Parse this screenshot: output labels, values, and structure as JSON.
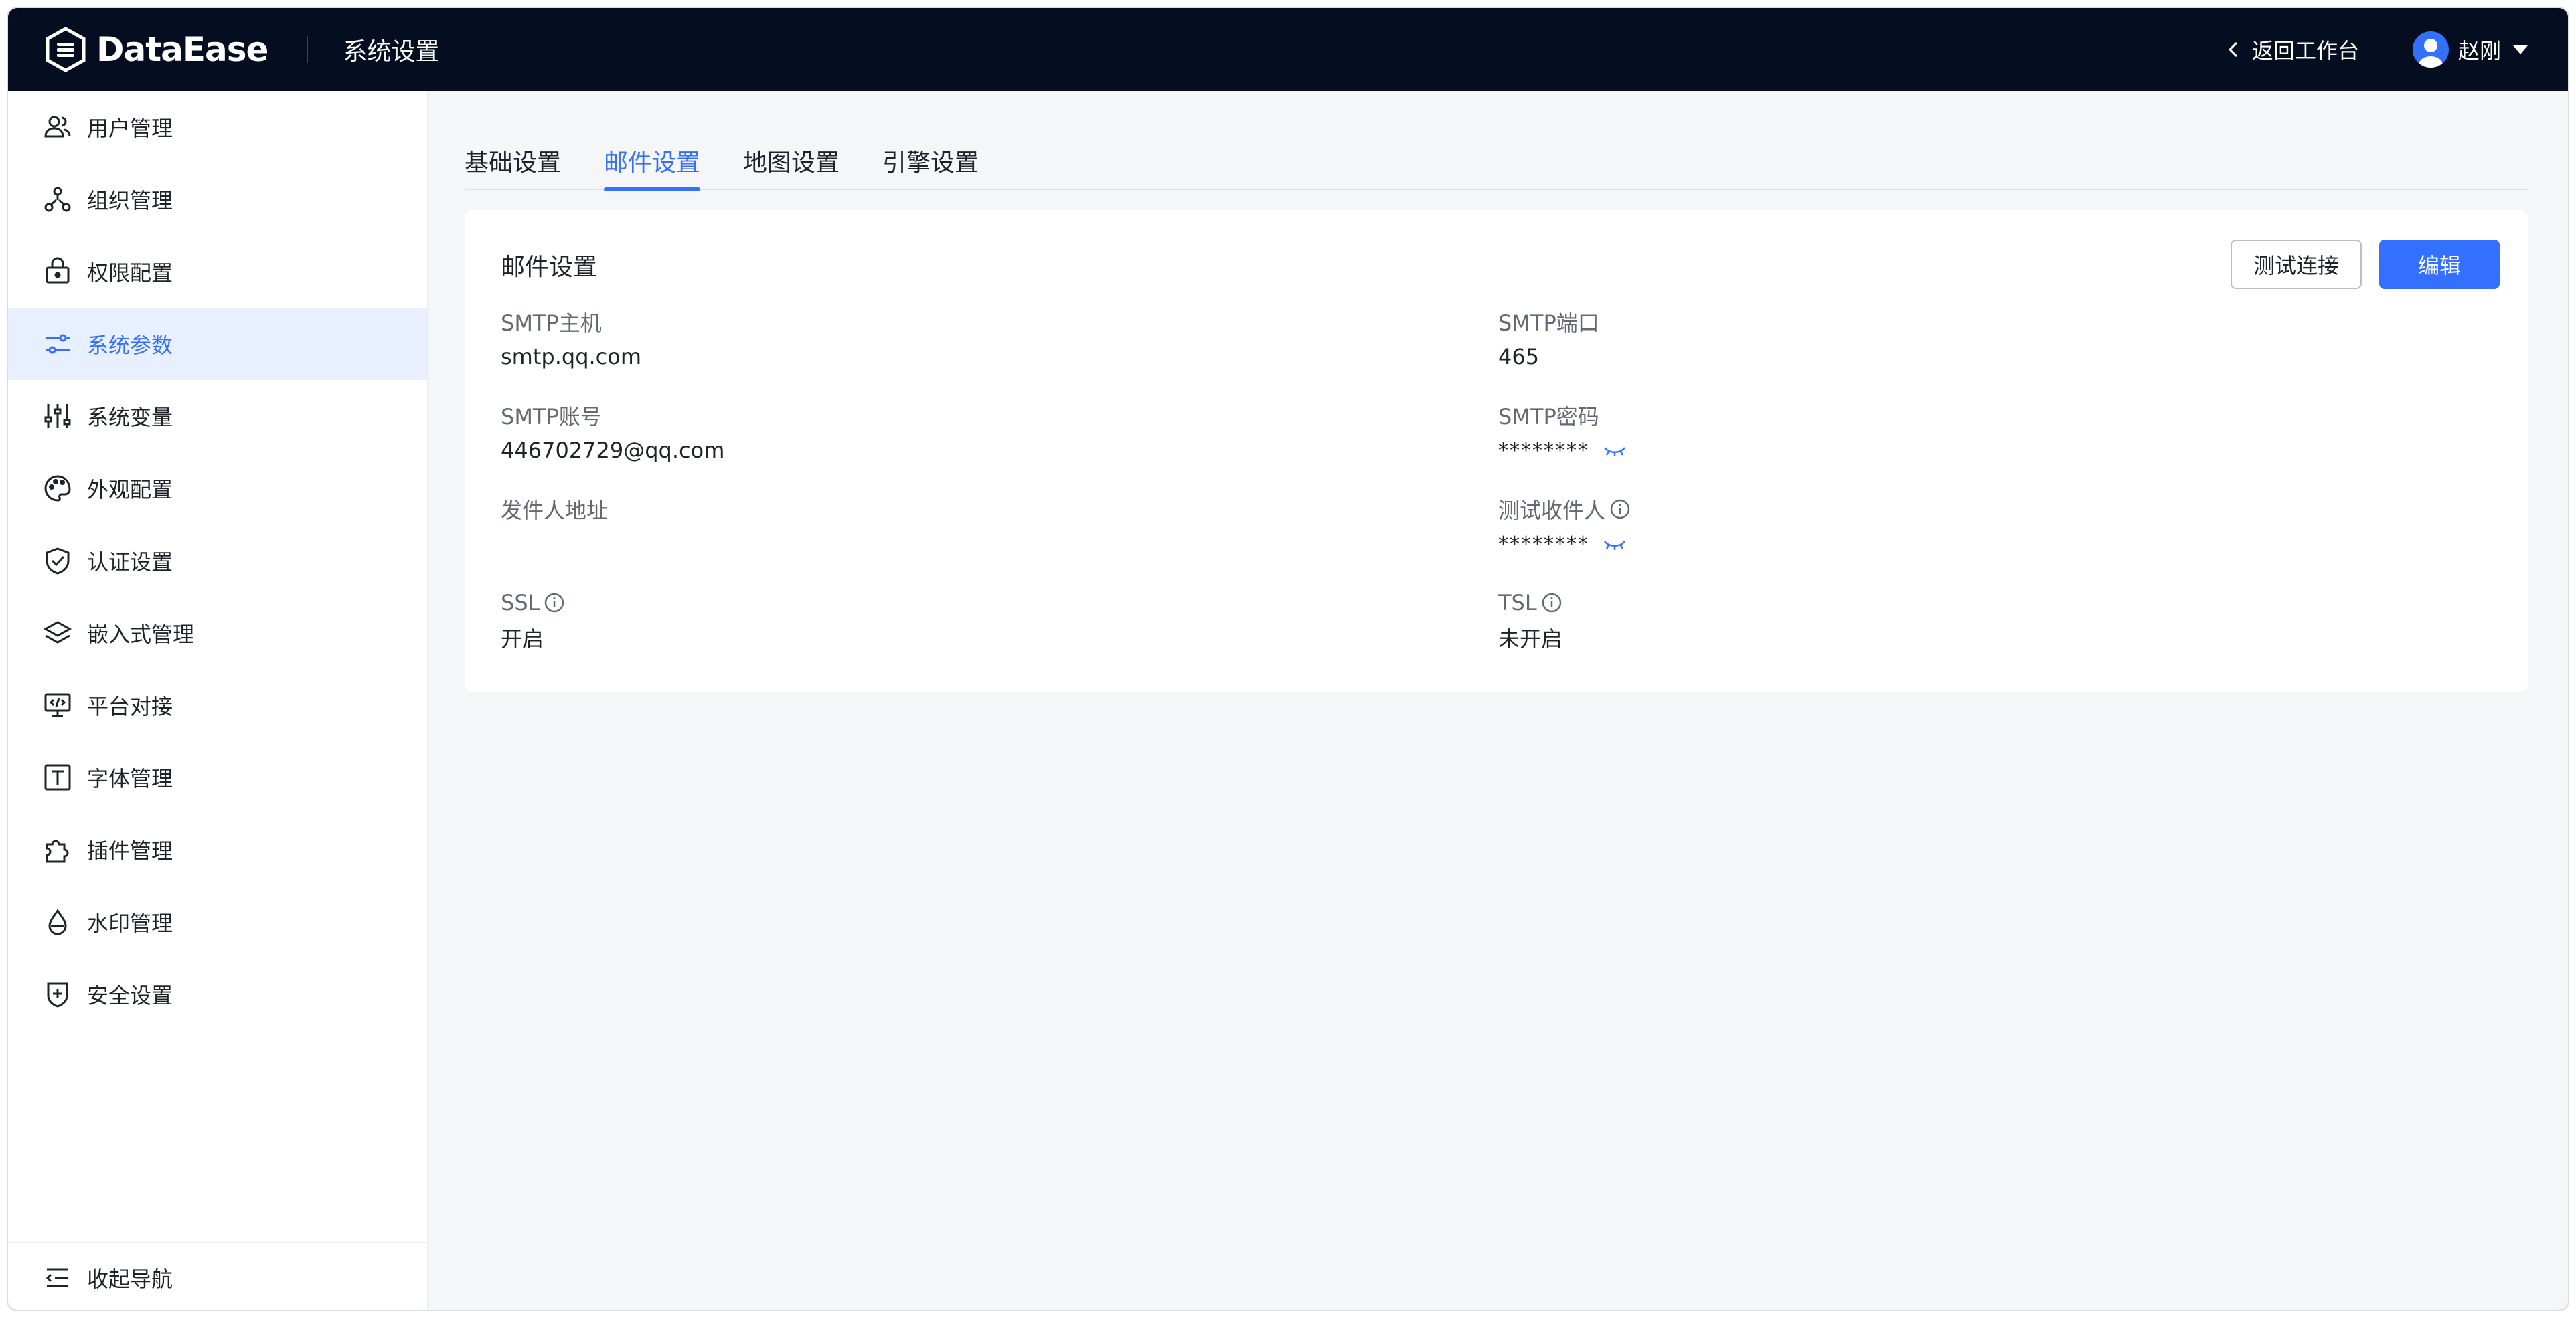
{
  "header": {
    "brand": "DataEase",
    "section_title": "系统设置",
    "back_label": "返回工作台",
    "user_name": "赵刚"
  },
  "sidebar": {
    "items": [
      {
        "label": "用户管理",
        "icon": "users-icon"
      },
      {
        "label": "组织管理",
        "icon": "org-tree-icon"
      },
      {
        "label": "权限配置",
        "icon": "lock-icon"
      },
      {
        "label": "系统参数",
        "icon": "sliders-icon",
        "active": true
      },
      {
        "label": "系统变量",
        "icon": "variables-icon"
      },
      {
        "label": "外观配置",
        "icon": "palette-icon"
      },
      {
        "label": "认证设置",
        "icon": "shield-check-icon"
      },
      {
        "label": "嵌入式管理",
        "icon": "layers-icon"
      },
      {
        "label": "平台对接",
        "icon": "code-monitor-icon"
      },
      {
        "label": "字体管理",
        "icon": "font-icon"
      },
      {
        "label": "插件管理",
        "icon": "puzzle-icon"
      },
      {
        "label": "水印管理",
        "icon": "drop-icon"
      },
      {
        "label": "安全设置",
        "icon": "shield-plus-icon"
      }
    ],
    "collapse_label": "收起导航"
  },
  "tabs": [
    {
      "label": "基础设置"
    },
    {
      "label": "邮件设置",
      "active": true
    },
    {
      "label": "地图设置"
    },
    {
      "label": "引擎设置"
    }
  ],
  "mail_card": {
    "title": "邮件设置",
    "test_button": "测试连接",
    "edit_button": "编辑",
    "fields": {
      "smtp_host": {
        "label": "SMTP主机",
        "value": "smtp.qq.com"
      },
      "smtp_port": {
        "label": "SMTP端口",
        "value": "465"
      },
      "smtp_account": {
        "label": "SMTP账号",
        "value": "446702729@qq.com"
      },
      "smtp_password": {
        "label": "SMTP密码",
        "value": "********"
      },
      "sender": {
        "label": "发件人地址",
        "value": ""
      },
      "test_recipient": {
        "label": "测试收件人",
        "value": "********"
      },
      "ssl": {
        "label": "SSL",
        "value": "开启"
      },
      "tsl": {
        "label": "TSL",
        "value": "未开启"
      }
    }
  },
  "colors": {
    "topbar": "#050e21",
    "accent": "#3370ff",
    "active_menu_bg": "#e8efff",
    "content_bg": "#f5f6f7"
  }
}
